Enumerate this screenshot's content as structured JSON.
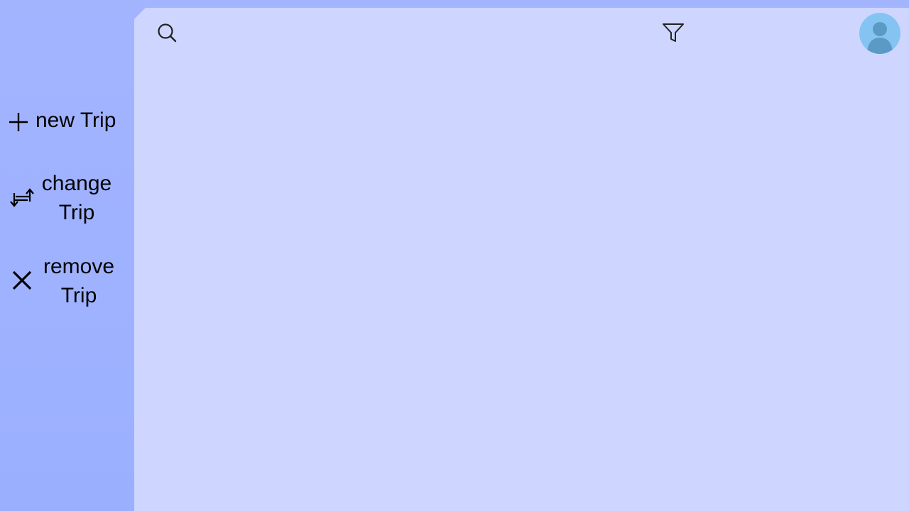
{
  "sidebar": {
    "items": [
      {
        "label": "new Trip",
        "icon": "plus-icon"
      },
      {
        "label": "change\nTrip",
        "icon": "swap-arrows-icon"
      },
      {
        "label": "remove\nTrip",
        "icon": "close-icon"
      }
    ]
  },
  "header": {
    "search_icon": "search-icon",
    "filter_icon": "filter-icon",
    "avatar_icon": "user-avatar-icon"
  },
  "colors": {
    "sidebar": "#a3b4ff",
    "main": "#ced6ff",
    "avatar": "#84c4f3",
    "avatar_figure": "#5c9ac6"
  }
}
